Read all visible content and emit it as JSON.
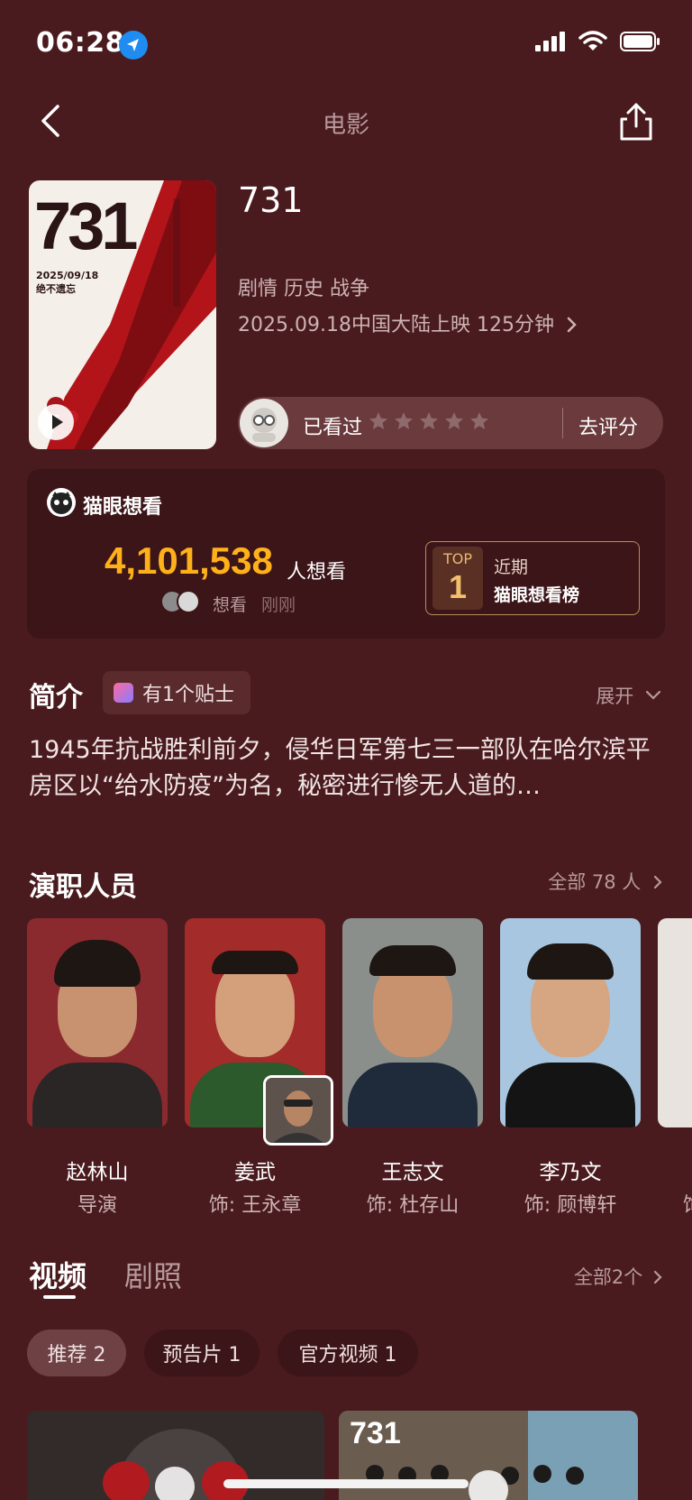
{
  "status": {
    "time": "06:28"
  },
  "nav": {
    "title": "电影"
  },
  "movie": {
    "poster_title": "731",
    "poster_date_line1": "2025/09/18",
    "poster_date_line2": "绝不遗忘",
    "title": "731",
    "genres": "剧情 历史 战争",
    "release": "2025.09.18中国大陆上映 125分钟"
  },
  "rating": {
    "seen_label": "已看过",
    "star_count": 5,
    "rate_label": "去评分"
  },
  "want": {
    "title": "猫眼想看",
    "count": "4,101,538",
    "unit": "人想看",
    "who": "想看",
    "time": "刚刚",
    "rank_top": "TOP",
    "rank_num": "1",
    "rank_line1": "近期",
    "rank_line2": "猫眼想看榜"
  },
  "intro": {
    "title": "简介",
    "tips": "有1个贴士",
    "expand": "展开",
    "text": "1945年抗战胜利前夕，侵华日军第七三一部队在哈尔滨平房区以“给水防疫”为名，秘密进行惨无人道的…"
  },
  "cast": {
    "title": "演职人员",
    "all": "全部 78 人",
    "members": [
      {
        "name": "赵林山",
        "role": "导演"
      },
      {
        "name": "姜武",
        "role": "饰: 王永章"
      },
      {
        "name": "王志文",
        "role": "饰: 杜存山"
      },
      {
        "name": "李乃文",
        "role": "饰: 顾博轩"
      }
    ],
    "partial_role": "饰"
  },
  "media": {
    "tab_video": "视频",
    "tab_photo": "剧照",
    "all": "全部2个",
    "chips": [
      "推荐 2",
      "预告片 1",
      "官方视频 1"
    ],
    "thumb2_text": "731"
  },
  "colors": {
    "background": "#4a1b1e",
    "accent": "#ffb11a"
  }
}
